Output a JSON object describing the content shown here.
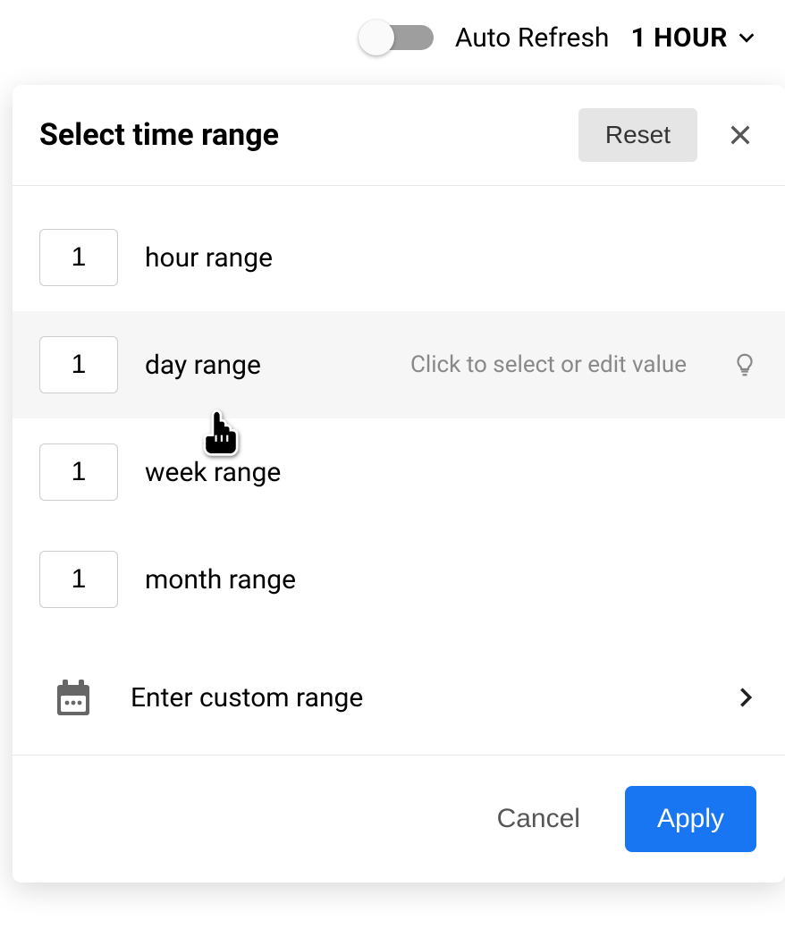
{
  "topbar": {
    "auto_refresh_label": "Auto Refresh",
    "selected_range": "1 HOUR"
  },
  "popover": {
    "title": "Select time range",
    "reset_label": "Reset",
    "hint_text": "Click to select or edit value",
    "options": [
      {
        "value": "1",
        "label": "hour range"
      },
      {
        "value": "1",
        "label": "day range"
      },
      {
        "value": "1",
        "label": "week range"
      },
      {
        "value": "1",
        "label": "month range"
      }
    ],
    "custom_label": "Enter custom range",
    "cancel_label": "Cancel",
    "apply_label": "Apply"
  }
}
